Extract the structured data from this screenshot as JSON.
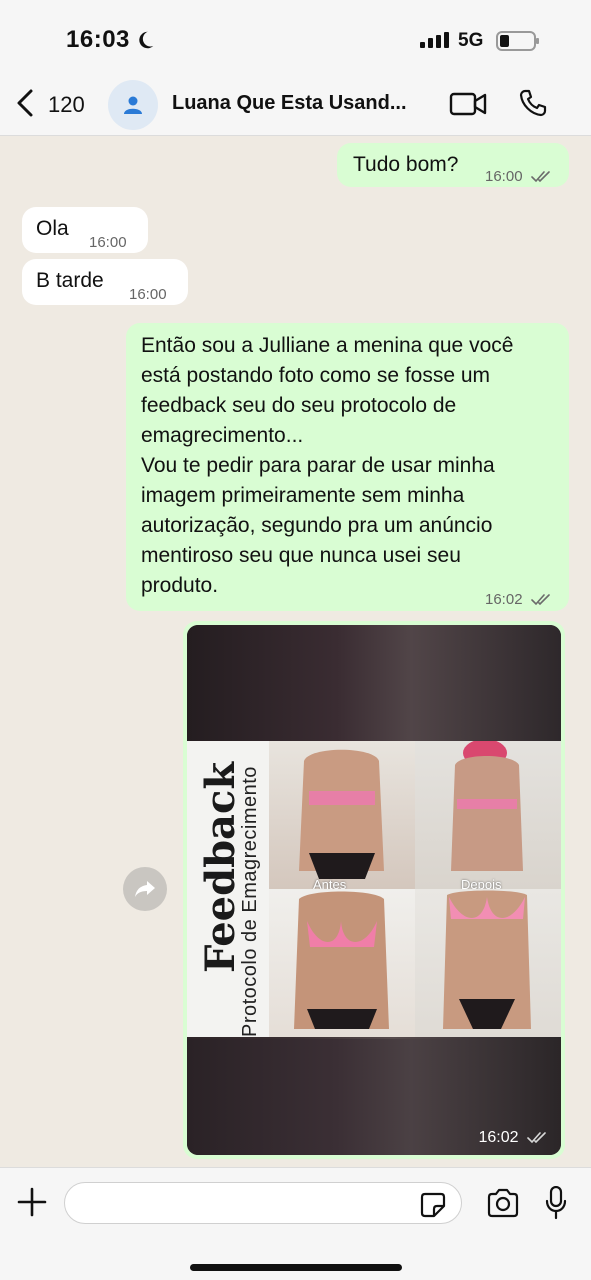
{
  "status_bar": {
    "time": "16:03",
    "network": "5G",
    "icons": [
      "moon-icon",
      "signal-icon",
      "battery-icon"
    ]
  },
  "header": {
    "back_count": "120",
    "contact_name": "Luana Que Esta Usand...",
    "icons": [
      "chevron-left-icon",
      "person-icon",
      "video-call-icon",
      "phone-icon"
    ]
  },
  "messages": [
    {
      "direction": "out",
      "text": "Tudo bom?",
      "time": "16:00"
    },
    {
      "direction": "in",
      "text": "Ola",
      "time": "16:00"
    },
    {
      "direction": "in",
      "text": "B tarde",
      "time": "16:00"
    },
    {
      "direction": "out",
      "lines": [
        "Então sou a Julliane a menina que você",
        "está postando foto como se fosse um",
        "feedback seu do seu protocolo de",
        "emagrecimento...",
        "Vou te pedir para parar de usar minha",
        "imagem primeiramente sem minha",
        "autorização, segundo pra um anúncio",
        "mentiroso seu que nunca usei seu",
        "produto."
      ],
      "time": "16:02"
    },
    {
      "direction": "out",
      "type": "image",
      "image_text": {
        "title": "Feedback",
        "subtitle": "Protocolo de Emagrecimento",
        "label_before": "Antes",
        "label_after": "Depois"
      },
      "time": "16:02"
    }
  ],
  "input": {
    "value": "",
    "icons": [
      "plus-icon",
      "sticker-icon",
      "camera-icon",
      "mic-icon"
    ]
  },
  "colors": {
    "chat_background": "#efeae2",
    "outgoing_bubble": "#d9fdd3",
    "incoming_bubble": "#ffffff",
    "read_ticks": "#6b6b6b"
  }
}
